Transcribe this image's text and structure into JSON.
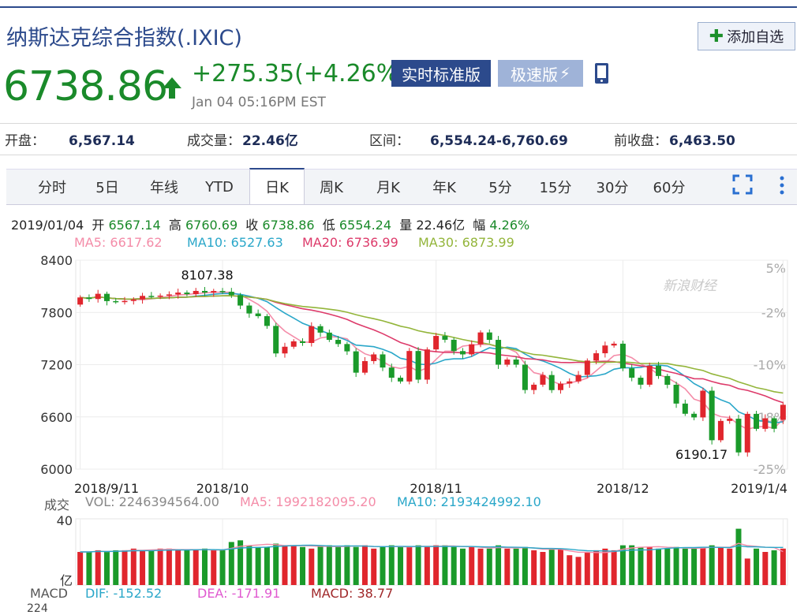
{
  "header": {
    "title": "纳斯达克综合指数(.IXIC)",
    "add_label": "添加自选",
    "price": "6738.86",
    "change": "+275.35(+4.26%)",
    "time": "Jan 04 05:16PM EST",
    "realtime_label": "实时标准版",
    "fast_label": "极速版",
    "up_color": "#e0262d",
    "down_color": "#1a9a2a"
  },
  "stats": {
    "open_label": "开盘：",
    "open": "6,567.14",
    "volume_label": "成交量：",
    "volume": "22.46亿",
    "range_label": "区间：",
    "range": "6,554.24-6,760.69",
    "prev_label": "前收盘：",
    "prev": "6,463.50"
  },
  "tabs": [
    "分时",
    "5日",
    "年线",
    "YTD",
    "日K",
    "周K",
    "月K",
    "年K",
    "5分",
    "15分",
    "30分",
    "60分"
  ],
  "active_tab": "日K",
  "info": {
    "date": "2019/01/04",
    "open_l": "开",
    "open": "6567.14",
    "high_l": "高",
    "high": "6760.69",
    "close_l": "收",
    "close": "6738.86",
    "low_l": "低",
    "low": "6554.24",
    "vol_l": "量",
    "vol": "22.46亿",
    "pct_l": "幅",
    "pct": "4.26%"
  },
  "ma": {
    "ma5": "MA5: 6617.62",
    "ma5_color": "#f48ca8",
    "ma10": "MA10: 6527.63",
    "ma10_color": "#2aa7c9",
    "ma20": "MA20: 6736.99",
    "ma20_color": "#dd3a6a",
    "ma30": "MA30: 6873.99",
    "ma30_color": "#93b53a"
  },
  "chart_data": {
    "type": "candlestick",
    "y_ticks": [
      "8400",
      "7800",
      "7200",
      "6600",
      "6000"
    ],
    "ylim": [
      6000,
      8400
    ],
    "pct_ticks": [
      "5%",
      "-2%",
      "-10%",
      "-18%",
      "-25%"
    ],
    "x_ticks": [
      "2018/9/11",
      "2018/10",
      "2018/11",
      "2018/12",
      "2019/1/4"
    ],
    "x_tick_index": [
      0,
      16,
      40,
      61,
      80
    ],
    "high_annot": "8107.38",
    "high_annot_index": 14,
    "low_annot": "6190.17",
    "low_annot_index": 74,
    "watermark": "新浪财经",
    "closes": [
      7972,
      7954,
      8014,
      7930,
      7924,
      7932,
      7950,
      7990,
      7986,
      7993,
      8007,
      8028,
      8010,
      8047,
      8028,
      8046,
      8037,
      7999,
      7879,
      7788,
      7757,
      7645,
      7329,
      7406,
      7468,
      7449,
      7642,
      7568,
      7485,
      7437,
      7353,
      7108,
      7241,
      7318,
      7167,
      7050,
      7007,
      7357,
      7028,
      7375,
      7530,
      7486,
      7356,
      7318,
      7434,
      7570,
      7485,
      7200,
      7259,
      7200,
      6909,
      6970,
      7081,
      6908,
      6983,
      7008,
      7082,
      7247,
      7331,
      7420,
      7441,
      7158,
      7050,
      6970,
      7188,
      7070,
      6969,
      6753,
      6636,
      6594,
      6901,
      6332,
      6554,
      6579,
      6192,
      6635,
      6463,
      6584,
      6464,
      6739
    ],
    "opens": [
      7890,
      7972,
      7954,
      8014,
      7930,
      7924,
      7932,
      7950,
      7990,
      7986,
      7993,
      8007,
      8028,
      8010,
      8047,
      8028,
      8046,
      8037,
      7999,
      7879,
      7788,
      7757,
      7645,
      7329,
      7406,
      7468,
      7449,
      7642,
      7568,
      7485,
      7437,
      7353,
      7108,
      7241,
      7318,
      7167,
      7050,
      7007,
      7357,
      7028,
      7375,
      7530,
      7486,
      7356,
      7318,
      7434,
      7570,
      7485,
      7200,
      7259,
      7200,
      6909,
      6970,
      7081,
      6908,
      6983,
      7008,
      7082,
      7247,
      7331,
      7420,
      7441,
      7158,
      7050,
      6970,
      7188,
      7070,
      6969,
      6753,
      6636,
      6594,
      6901,
      6332,
      6554,
      6579,
      6192,
      6635,
      6463,
      6584,
      6567
    ],
    "volume": {
      "label": "成交",
      "vol_text": "VOL: 2246394564.00",
      "ma5_text": "MA5: 1992182095.20",
      "ma10_text": "MA10: 2193424992.10",
      "tick_top": "40",
      "unit": "亿",
      "values": [
        20,
        20,
        21,
        20,
        21,
        21,
        22,
        21,
        21,
        22,
        22,
        21,
        21,
        21,
        22,
        21,
        21,
        26,
        27,
        24,
        23,
        23,
        25,
        24,
        24,
        23,
        22,
        24,
        24,
        23,
        24,
        23,
        24,
        22,
        23,
        24,
        23,
        23,
        24,
        23,
        24,
        24,
        23,
        22,
        23,
        22,
        22,
        24,
        22,
        22,
        23,
        21,
        20,
        22,
        22,
        18,
        17,
        20,
        21,
        22,
        21,
        24,
        24,
        23,
        23,
        22,
        22,
        23,
        22,
        22,
        23,
        24,
        23,
        22,
        34,
        16,
        22,
        20,
        21,
        22
      ]
    },
    "macd": {
      "label": "MACD",
      "dif": "DIF: -152.52",
      "dea": "DEA: -171.91",
      "val": "MACD: 38.77",
      "next_tick": "224"
    }
  }
}
